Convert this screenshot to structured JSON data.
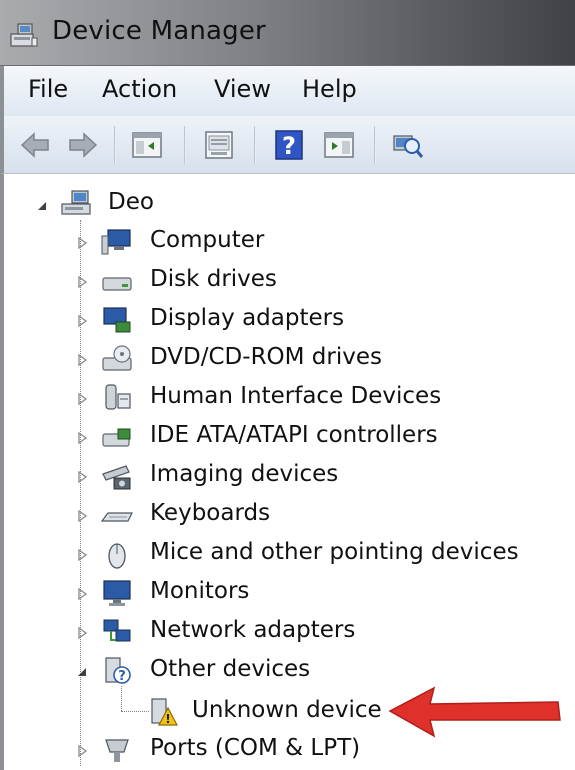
{
  "window": {
    "title": "Device Manager"
  },
  "menu": [
    "File",
    "Action",
    "View",
    "Help"
  ],
  "toolbar": {
    "buttons": [
      "back-icon",
      "forward-icon",
      "show-hide-console-tree-icon",
      "properties-icon",
      "help-icon",
      "action-pane-icon",
      "scan-hardware-icon"
    ]
  },
  "tree": {
    "root": "Deo",
    "categories": [
      "Computer",
      "Disk drives",
      "Display adapters",
      "DVD/CD-ROM drives",
      "Human Interface Devices",
      "IDE ATA/ATAPI controllers",
      "Imaging devices",
      "Keyboards",
      "Mice and other pointing devices",
      "Monitors",
      "Network adapters",
      "Other devices",
      "Ports (COM & LPT)"
    ],
    "other_devices_children": [
      "Unknown device"
    ]
  },
  "annotation": {
    "arrow_color": "#e0302b"
  }
}
